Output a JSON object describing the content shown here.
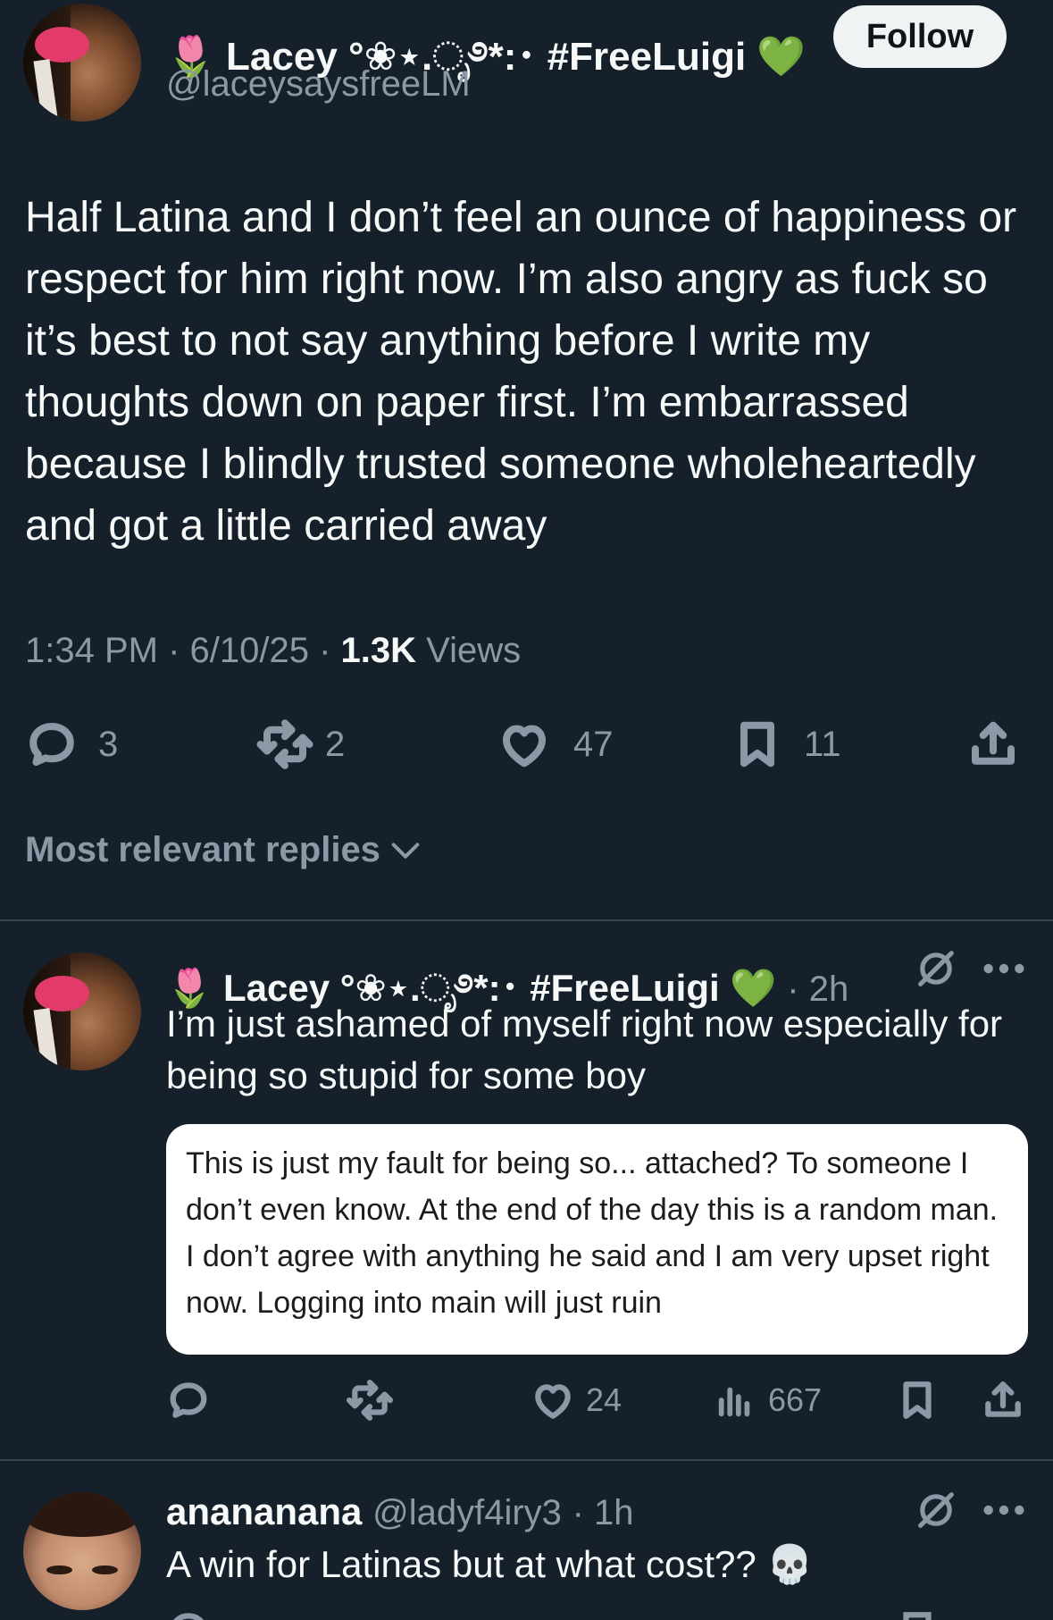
{
  "tweet": {
    "author_name": "Lacey °❀⋆.ೃ࿔*:･ #FreeLuigi",
    "author_emoji_prefix": "🌷",
    "author_emoji_suffix": "💚",
    "author_handle": "@laceysaysfreeLM",
    "follow_label": "Follow",
    "text": "Half Latina and I don’t feel an ounce of happiness or respect for him right now. I’m also angry as fuck so it’s best to not say anything before I write my thoughts down on paper first. I’m embarrassed because I blindly trusted someone wholeheartedly and got a little carried away",
    "time": "1:34 PM",
    "date": "6/10/25",
    "views_count": "1.3K",
    "views_label": "Views",
    "replies": "3",
    "reposts": "2",
    "likes": "47",
    "bookmarks": "11"
  },
  "sort": {
    "label": "Most relevant replies"
  },
  "replies": [
    {
      "author_name": "Lacey °❀⋆.ೃ࿔*:･ #FreeLuigi",
      "author_emoji_prefix": "🌷",
      "author_emoji_suffix": "💚",
      "time": "· 2h",
      "text": "I’m just ashamed of myself right now especially for being so stupid for some boy",
      "card_text": "This is just my fault for being so... attached? To someone I don’t even know. At the end of the day this is a random man. I don’t agree with anything he said and I am very upset right now. Logging into main will just ruin",
      "likes": "24",
      "views": "667"
    },
    {
      "author_name": "anananana",
      "author_handle": "@ladyf4iry3",
      "time": "· 1h",
      "text": "A win for Latinas but at what cost?? 💀"
    }
  ],
  "colors": {
    "background": "#15202b",
    "muted": "#8b98a5",
    "divider": "#38444d",
    "text": "#f7f9f9"
  },
  "icons": [
    "reply-icon",
    "repost-icon",
    "like-icon",
    "bookmark-icon",
    "share-icon",
    "views-icon",
    "grok-icon",
    "more-icon",
    "chevron-down-icon"
  ]
}
